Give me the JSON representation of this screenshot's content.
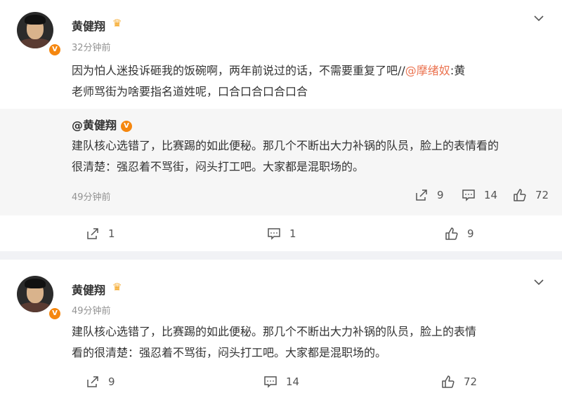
{
  "posts": [
    {
      "author": "黄健翔",
      "time": "32分钟前",
      "text_plain1": "因为怕人迷投诉砸我的饭碗啊，两年前说过的话，不需要重复了吧//",
      "mention": "@摩绪奴",
      "text_plain2": ":黄",
      "text_line2": "老师骂街为啥要指名道姓呢，口合口合口合口合",
      "repost": {
        "author": "@黄健翔",
        "line1": "建队核心选错了，比赛踢的如此便秘。那几个不断出大力补锅的队员，脸上的表情看的",
        "line2": "很清楚：强忍着不骂街，闷头打工吧。大家都是混职场的。",
        "time": "49分钟前",
        "shares": "9",
        "comments": "14",
        "likes": "72"
      },
      "shares": "1",
      "comments": "1",
      "likes": "9"
    },
    {
      "author": "黄健翔",
      "time": "49分钟前",
      "line1": "建队核心选错了，比赛踢的如此便秘。那几个不断出大力补锅的队员，脸上的表情",
      "line2": "看的很清楚：强忍着不骂街，闷头打工吧。大家都是混职场的。",
      "shares": "9",
      "comments": "14",
      "likes": "72"
    }
  ],
  "icons": {
    "share": "share-icon",
    "comment": "comment-icon",
    "like": "thumbs-up-icon",
    "more": "chevron-down-icon",
    "verified": "verified-v-icon",
    "member": "crown-icon"
  },
  "colors": {
    "mention": "#eb7350",
    "verified": "#f5870f",
    "background": "#f1f2f5",
    "repost_bg": "#f6f6f6"
  }
}
